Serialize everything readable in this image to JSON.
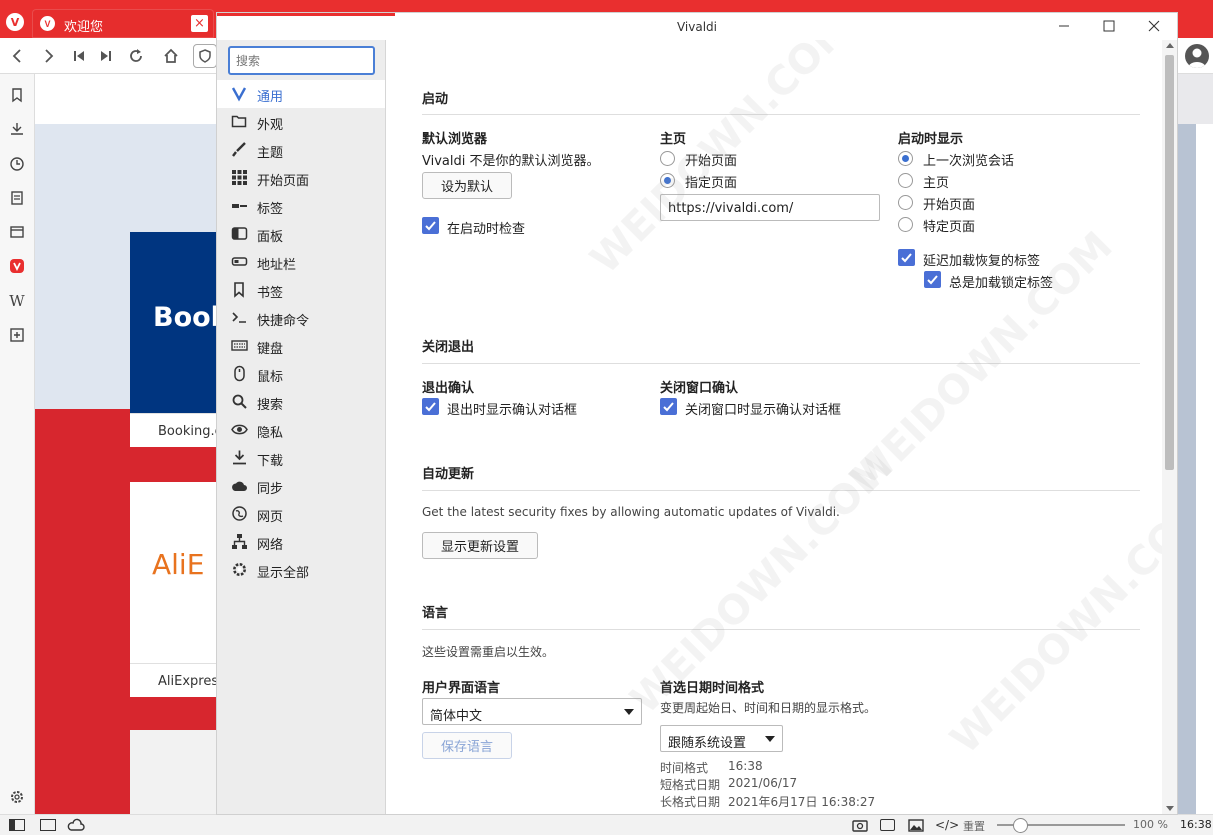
{
  "browser": {
    "tab_title": "欢迎您",
    "tab_close": "×",
    "status_zoom_reset": "重置",
    "status_zoom": "100 %",
    "status_time": "16:38"
  },
  "content_cards": [
    {
      "brand": "Book",
      "label": "Booking.co",
      "color": "#003580",
      "brand_color": "#ffffff"
    },
    {
      "brand": "AliE",
      "label": "AliExpress",
      "color": "#ffffff",
      "brand_color": "#e8731f"
    }
  ],
  "window": {
    "title": "Vivaldi",
    "minimize": "—",
    "maximize": "☐",
    "close": "✕"
  },
  "search": {
    "placeholder": "搜索"
  },
  "sidebar": {
    "items": [
      {
        "label": "通用",
        "icon": "vivaldi-icon",
        "active": true
      },
      {
        "label": "外观",
        "icon": "folder-icon"
      },
      {
        "label": "主题",
        "icon": "brush-icon"
      },
      {
        "label": "开始页面",
        "icon": "grid-icon"
      },
      {
        "label": "标签",
        "icon": "tabs-icon"
      },
      {
        "label": "面板",
        "icon": "panel-icon"
      },
      {
        "label": "地址栏",
        "icon": "address-bar-icon"
      },
      {
        "label": "书签",
        "icon": "bookmark-icon"
      },
      {
        "label": "快捷命令",
        "icon": "command-icon"
      },
      {
        "label": "键盘",
        "icon": "keyboard-icon"
      },
      {
        "label": "鼠标",
        "icon": "mouse-icon"
      },
      {
        "label": "搜索",
        "icon": "search-icon"
      },
      {
        "label": "隐私",
        "icon": "eye-icon"
      },
      {
        "label": "下载",
        "icon": "download-icon"
      },
      {
        "label": "同步",
        "icon": "cloud-icon"
      },
      {
        "label": "网页",
        "icon": "globe-icon"
      },
      {
        "label": "网络",
        "icon": "network-icon"
      },
      {
        "label": "显示全部",
        "icon": "gear-icon"
      }
    ]
  },
  "startup": {
    "section_title": "启动",
    "default_browser": {
      "title": "默认浏览器",
      "status": "Vivaldi 不是你的默认浏览器。",
      "button": "设为默认",
      "check_label": "在启动时检查",
      "check_checked": true
    },
    "homepage": {
      "title": "主页",
      "options": [
        {
          "label": "开始页面",
          "selected": false
        },
        {
          "label": "指定页面",
          "selected": true
        }
      ],
      "url": "https://vivaldi.com/"
    },
    "on_startup": {
      "title": "启动时显示",
      "options": [
        {
          "label": "上一次浏览会话",
          "selected": true
        },
        {
          "label": "主页",
          "selected": false
        },
        {
          "label": "开始页面",
          "selected": false
        },
        {
          "label": "特定页面",
          "selected": false
        }
      ],
      "lazy_load_label": "延迟加载恢复的标签",
      "always_load_pinned_label": "总是加载锁定标签"
    }
  },
  "quit": {
    "section_title": "关闭退出",
    "exit_confirm": {
      "title": "退出确认",
      "check_label": "退出时显示确认对话框"
    },
    "close_window_confirm": {
      "title": "关闭窗口确认",
      "check_label": "关闭窗口时显示确认对话框"
    }
  },
  "updates": {
    "section_title": "自动更新",
    "description": "Get the latest security fixes by allowing automatic updates of Vivaldi.",
    "button": "显示更新设置"
  },
  "language": {
    "section_title": "语言",
    "note": "这些设置需重启以生效。",
    "ui_language": {
      "title": "用户界面语言",
      "value": "简体中文",
      "save_button": "保存语言"
    },
    "date_format": {
      "title": "首选日期时间格式",
      "description": "变更周起始日、时间和日期的显示格式。",
      "value": "跟随系统设置",
      "rows": [
        {
          "key": "时间格式",
          "value": "16:38"
        },
        {
          "key": "短格式日期",
          "value": "2021/06/17"
        },
        {
          "key": "长格式日期",
          "value": "2021年6月17日 16:38:27"
        }
      ]
    }
  }
}
